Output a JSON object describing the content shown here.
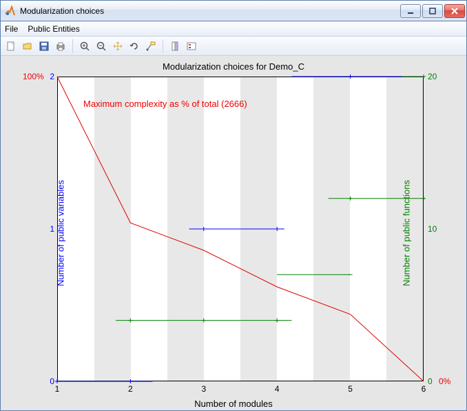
{
  "window": {
    "title": "Modularization choices"
  },
  "menu": {
    "file": "File",
    "public_entities": "Public Entities"
  },
  "toolbar_icons": [
    "new-file-icon",
    "open-icon",
    "save-icon",
    "print-icon",
    "zoom-in-icon",
    "zoom-out-icon",
    "pan-icon",
    "rotate-icon",
    "data-cursor-icon",
    "link-icon",
    "legend-icon"
  ],
  "colors": {
    "blue": "#0000ff",
    "green": "#008000",
    "red": "#e00000",
    "grid_band": "#e8e8e8"
  },
  "chart": {
    "title": "Modularization choices for Demo_C",
    "xlabel": "Number of modules",
    "ylabel_left": "Number of public variables",
    "ylabel_right": "Number of public functions",
    "annotation": "Maximum complexity as % of total (2666)",
    "x_ticks": {
      "v1": "1",
      "v2": "2",
      "v3": "3",
      "v4": "4",
      "v5": "5",
      "v6": "6"
    },
    "y_left_ticks": {
      "v0": "0",
      "v1": "1",
      "v2": "2"
    },
    "y_right_ticks": {
      "v0": "0",
      "v10": "10",
      "v20": "20"
    },
    "red_ticks": {
      "top": "100%",
      "bot": "0%"
    }
  },
  "chart_data": {
    "type": "line",
    "title": "Modularization choices for Demo_C",
    "xlabel": "Number of modules",
    "x": [
      1,
      2,
      3,
      4,
      5,
      6
    ],
    "series": [
      {
        "name": "Maximum complexity as % of total (2666)",
        "axis": "red",
        "ylabel": "Maximum complexity % of total",
        "ylim": [
          0,
          100
        ],
        "values": [
          100,
          52,
          43,
          31,
          22,
          0
        ]
      },
      {
        "name": "Number of public variables",
        "axis": "left",
        "ylabel": "Number of public variables",
        "ylim": [
          0,
          2
        ],
        "type": "step-segments",
        "segments": [
          {
            "x0": 1.0,
            "x1": 2.3,
            "y": 0
          },
          {
            "x0": 2.8,
            "x1": 4.1,
            "y": 1
          },
          {
            "x0": 4.2,
            "x1": 6.0,
            "y": 2
          }
        ],
        "markers_x": [
          1,
          2,
          3,
          4,
          5,
          6
        ]
      },
      {
        "name": "Number of public functions",
        "axis": "right",
        "ylabel": "Number of public functions",
        "ylim": [
          0,
          20
        ],
        "type": "step-segments",
        "segments": [
          {
            "x0": 1.8,
            "x1": 4.2,
            "y": 4
          },
          {
            "x0": 4.0,
            "x1": 5.0,
            "y": 7
          },
          {
            "x0": 4.7,
            "x1": 6.0,
            "y": 12
          },
          {
            "x0": 5.7,
            "x1": 6.0,
            "y": 20
          }
        ],
        "markers_x": [
          2,
          3,
          4,
          5,
          6
        ]
      }
    ]
  }
}
